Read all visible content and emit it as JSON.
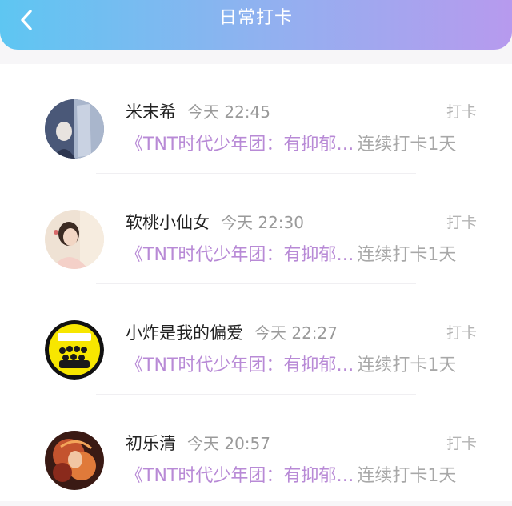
{
  "header": {
    "title": "日常打卡"
  },
  "entries": [
    {
      "name": "米末希",
      "time": "今天 22:45",
      "action": "打卡",
      "topic": "《TNT时代少年团：有抑郁…",
      "streak": "连续打卡1天"
    },
    {
      "name": "软桃小仙女",
      "time": "今天 22:30",
      "action": "打卡",
      "topic": "《TNT时代少年团：有抑郁…",
      "streak": "连续打卡1天"
    },
    {
      "name": "小炸是我的偏爱",
      "time": "今天 22:27",
      "action": "打卡",
      "topic": "《TNT时代少年团：有抑郁…",
      "streak": "连续打卡1天"
    },
    {
      "name": "初乐清",
      "time": "今天 20:57",
      "action": "打卡",
      "topic": "《TNT时代少年团：有抑郁…",
      "streak": "连续打卡1天"
    }
  ],
  "colors": {
    "header_gradient_start": "#5ec6f2",
    "header_gradient_end": "#b79aee",
    "topic_purple": "#b88ad6",
    "muted_gray": "#a8a8a8"
  },
  "icons": {
    "back": "chevron-left-icon"
  }
}
